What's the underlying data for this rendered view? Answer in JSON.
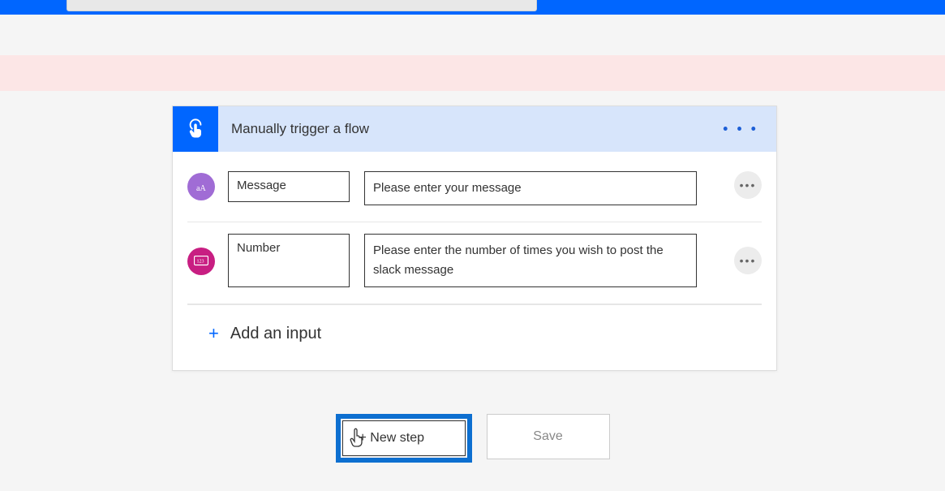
{
  "trigger": {
    "title": "Manually trigger a flow",
    "inputs": [
      {
        "icon": "text-icon",
        "name": "Message",
        "prompt": "Please enter your message"
      },
      {
        "icon": "number-icon",
        "name": "Number",
        "prompt": "Please enter the number of times you wish to post the slack message"
      }
    ],
    "add_input_label": "Add an input"
  },
  "buttons": {
    "new_step": "+ New step",
    "save": "Save"
  }
}
